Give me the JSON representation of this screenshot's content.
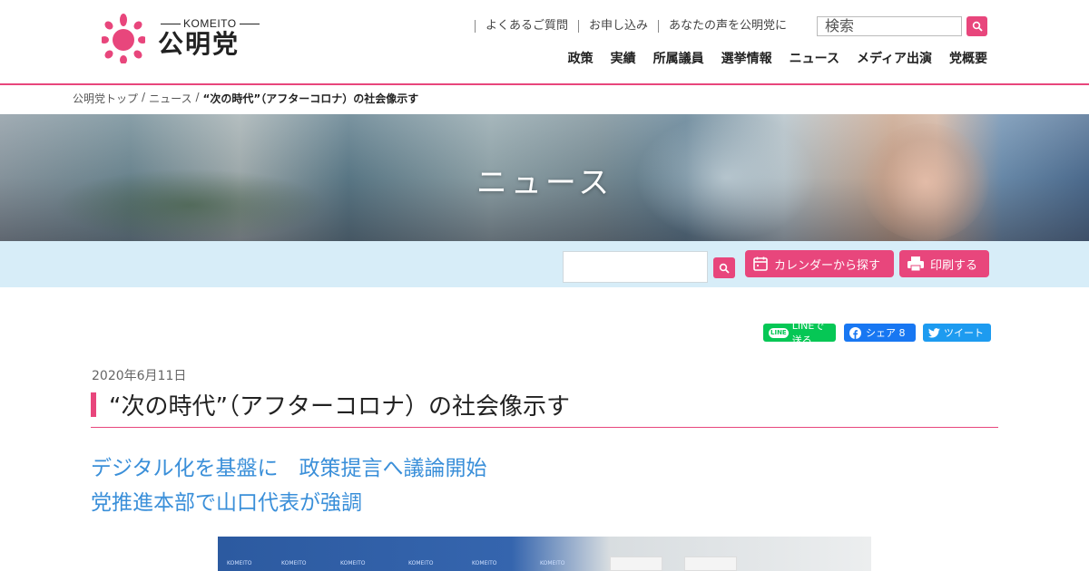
{
  "logo": {
    "en": "KOMEITO",
    "jp": "公明党"
  },
  "util_links": [
    "よくあるご質問",
    "お申し込み",
    "あなたの声を公明党に"
  ],
  "search": {
    "placeholder": "検索"
  },
  "gnav": [
    "政策",
    "実績",
    "所属議員",
    "選挙情報",
    "ニュース",
    "メディア出演",
    "党概要"
  ],
  "breadcrumb": {
    "home": "公明党トップ",
    "section": "ニュース",
    "current": "“次の時代”（アフターコロナ）の社会像示す"
  },
  "hero": {
    "title": "ニュース"
  },
  "toolbar": {
    "calendar_label": "カレンダーから探す",
    "print_label": "印刷する"
  },
  "share": {
    "line_icon": "LINE",
    "line_label": "LINEで送る",
    "facebook_label": "シェア 8",
    "twitter_label": "ツイート"
  },
  "article": {
    "date": "2020年6月11日",
    "title": "“次の時代”（アフターコロナ）の社会像示す",
    "subtitle_1": "デジタル化を基盤に　政策提言へ議論開始",
    "subtitle_2": "党推進本部で山口代表が強調"
  },
  "photo": {
    "backdrop_text": "KOMEITO"
  },
  "colors": {
    "accent": "#e8467c",
    "subtitle": "#3a8fd9",
    "toolbar_bg": "#d7edf8"
  }
}
